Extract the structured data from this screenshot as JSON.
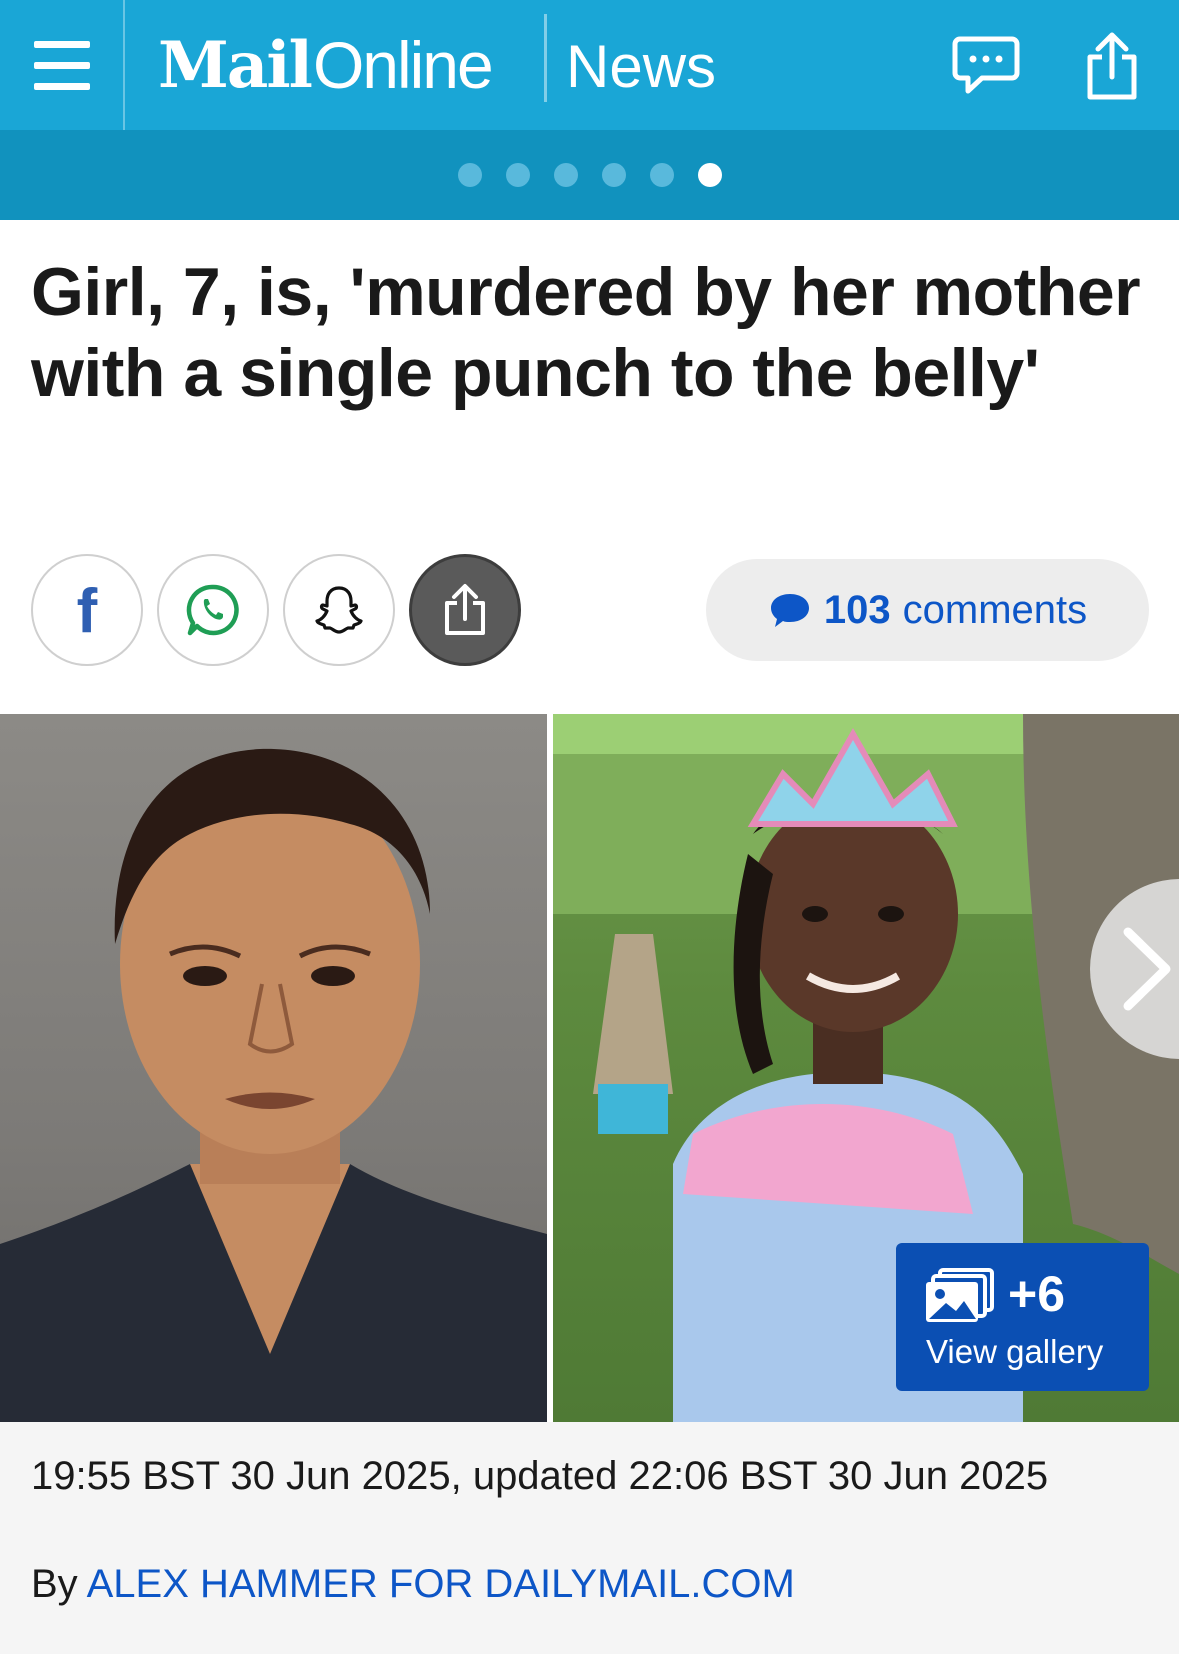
{
  "header": {
    "brand_bold": "Mail",
    "brand_light": "Online",
    "section": "News",
    "colors": {
      "bar": "#1aa6d6",
      "dots_bar": "#1192be"
    },
    "icons": [
      "menu-icon",
      "comment-icon",
      "share-icon"
    ]
  },
  "carousel": {
    "total": 6,
    "active_index": 5
  },
  "article": {
    "headline": "Girl, 7, is, 'murdered by her mother with a single punch to the belly'",
    "share_buttons": [
      "facebook-icon",
      "whatsapp-icon",
      "snapchat-icon",
      "share-icon"
    ],
    "facebook_letter": "f",
    "comments": {
      "count": "103",
      "label": "comments"
    },
    "gallery": {
      "count": "+6",
      "label": "View gallery"
    },
    "timestamp": "19:55 BST 30 Jun 2025, updated 22:06 BST 30 Jun 2025",
    "byline_prefix": "By",
    "author": "ALEX HAMMER FOR DAILYMAIL.COM"
  }
}
